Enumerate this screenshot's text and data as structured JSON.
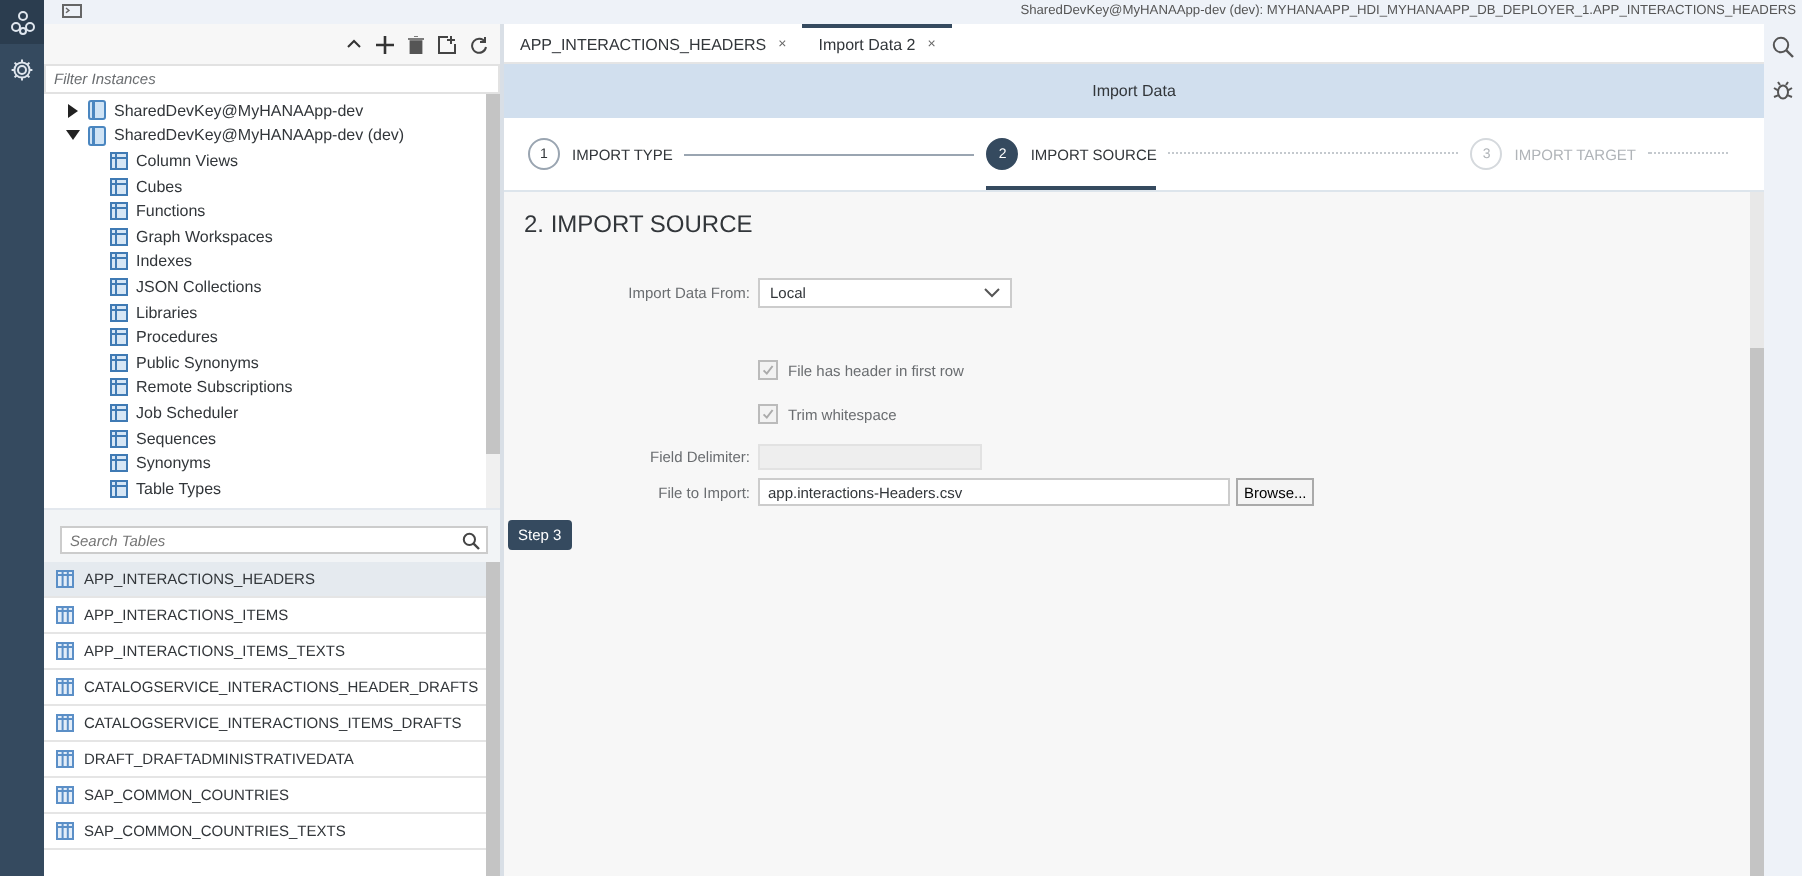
{
  "top_bar": {
    "path": "SharedDevKey@MyHANAApp-dev (dev): MYHANAAPP_HDI_MYHANAAPP_DB_DEPLOYER_1.APP_INTERACTIONS_HEADERS"
  },
  "instances": {
    "filter_placeholder": "Filter Instances",
    "tree": [
      {
        "label": "SharedDevKey@MyHANAApp-dev",
        "expanded": false
      },
      {
        "label": "SharedDevKey@MyHANAApp-dev (dev)",
        "expanded": true,
        "children": [
          {
            "label": "Column Views"
          },
          {
            "label": "Cubes"
          },
          {
            "label": "Functions"
          },
          {
            "label": "Graph Workspaces"
          },
          {
            "label": "Indexes"
          },
          {
            "label": "JSON Collections"
          },
          {
            "label": "Libraries"
          },
          {
            "label": "Procedures"
          },
          {
            "label": "Public Synonyms"
          },
          {
            "label": "Remote Subscriptions"
          },
          {
            "label": "Job Scheduler"
          },
          {
            "label": "Sequences"
          },
          {
            "label": "Synonyms"
          },
          {
            "label": "Table Types"
          }
        ]
      }
    ]
  },
  "tables": {
    "search_placeholder": "Search Tables",
    "rows": [
      {
        "name": "APP_INTERACTIONS_HEADERS",
        "selected": true
      },
      {
        "name": "APP_INTERACTIONS_ITEMS",
        "selected": false
      },
      {
        "name": "APP_INTERACTIONS_ITEMS_TEXTS",
        "selected": false
      },
      {
        "name": "CATALOGSERVICE_INTERACTIONS_HEADER_DRAFTS",
        "selected": false
      },
      {
        "name": "CATALOGSERVICE_INTERACTIONS_ITEMS_DRAFTS",
        "selected": false
      },
      {
        "name": "DRAFT_DRAFTADMINISTRATIVEDATA",
        "selected": false
      },
      {
        "name": "SAP_COMMON_COUNTRIES",
        "selected": false
      },
      {
        "name": "SAP_COMMON_COUNTRIES_TEXTS",
        "selected": false
      }
    ]
  },
  "tabs": [
    {
      "label": "APP_INTERACTIONS_HEADERS",
      "close": "×",
      "selected": false
    },
    {
      "label": "Import Data 2",
      "close": "×",
      "selected": true
    }
  ],
  "wizard": {
    "title": "Import Data",
    "steps": [
      {
        "number": "1",
        "label": "IMPORT TYPE",
        "selected": false,
        "disabled": false
      },
      {
        "number": "2",
        "label": "IMPORT SOURCE",
        "selected": true,
        "disabled": false
      },
      {
        "number": "3",
        "label": "IMPORT TARGET",
        "selected": false,
        "disabled": true
      }
    ],
    "section_title": "2. IMPORT SOURCE",
    "import_from": {
      "label": "Import Data From:",
      "value": "Local"
    },
    "checkboxes": [
      {
        "label": "File has header in first row",
        "checked": true,
        "disabled": true
      },
      {
        "label": "Trim whitespace",
        "checked": true,
        "disabled": true
      }
    ],
    "field_delimiter": {
      "label": "Field Delimiter:",
      "disabled": true
    },
    "file": {
      "label": "File to Import:",
      "value": "app.interactions-Headers.csv",
      "button": "Browse..."
    },
    "next_button": "Step 3"
  }
}
